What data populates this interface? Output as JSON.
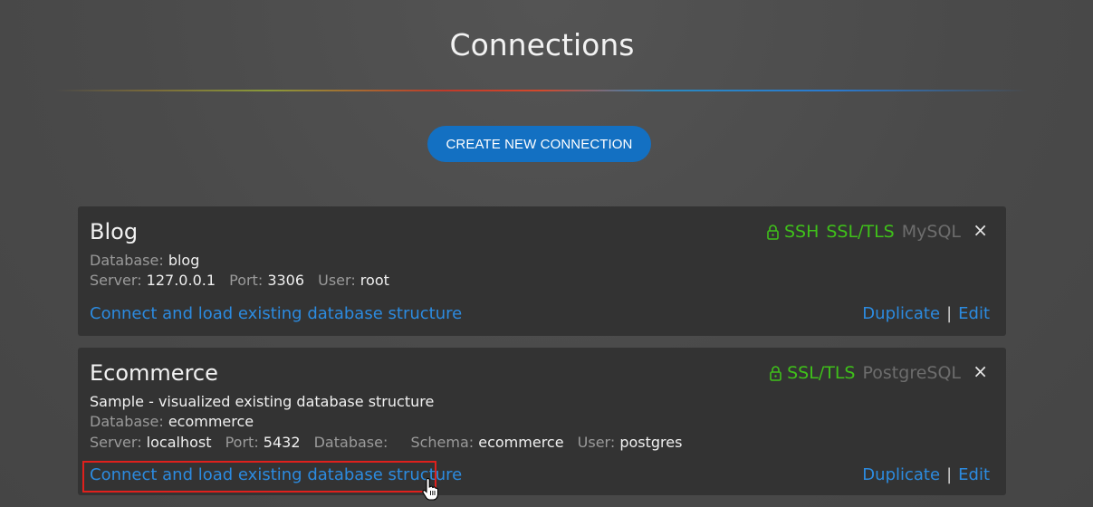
{
  "page": {
    "title": "Connections",
    "create_button_label": "CREATE NEW CONNECTION"
  },
  "colors": {
    "accent": "#1370c2",
    "link": "#2c8be0",
    "ssl_green": "#3fc11a",
    "card_bg": "#333333",
    "highlight": "#e0201c"
  },
  "connections": [
    {
      "name": "Blog",
      "badges": {
        "ssh": "SSH",
        "ssl": "SSL/TLS",
        "db_type": "MySQL"
      },
      "close_icon": "×",
      "fields": {
        "database_label": "Database:",
        "database": "blog",
        "server_label": "Server:",
        "server": "127.0.0.1",
        "port_label": "Port:",
        "port": "3306",
        "user_label": "User:",
        "user": "root"
      },
      "connect_label": "Connect and load existing database structure",
      "duplicate_label": "Duplicate",
      "separator": "|",
      "edit_label": "Edit"
    },
    {
      "name": "Ecommerce",
      "description": "Sample - visualized existing database structure",
      "badges": {
        "ssl": "SSL/TLS",
        "db_type": "PostgreSQL"
      },
      "close_icon": "×",
      "fields": {
        "database_label": "Database:",
        "database": "ecommerce",
        "server_label": "Server:",
        "server": "localhost",
        "port_label": "Port:",
        "port": "5432",
        "database2_label": "Database:",
        "schema_label": "Schema:",
        "schema": "ecommerce",
        "user_label": "User:",
        "user": "postgres"
      },
      "connect_label": "Connect and load existing database structure",
      "duplicate_label": "Duplicate",
      "separator": "|",
      "edit_label": "Edit"
    }
  ]
}
